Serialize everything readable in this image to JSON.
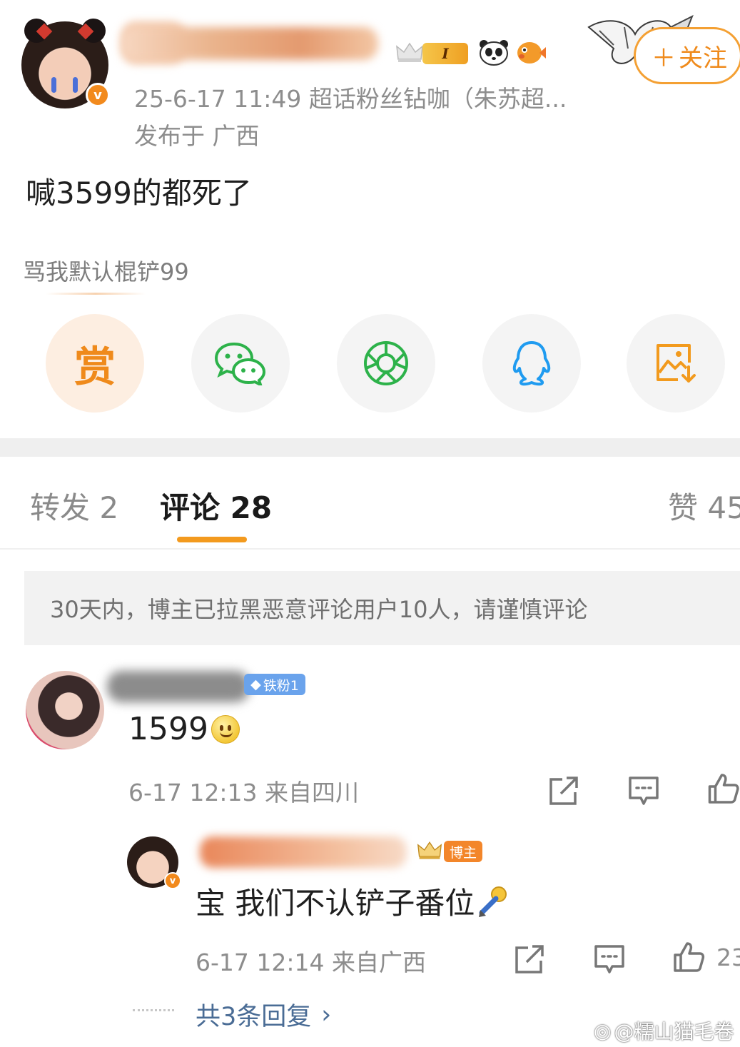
{
  "post": {
    "level_badge": "I",
    "timestamp_source": "25-6-17 11:49  超话粉丝钻咖（朱苏超...",
    "location": "发布于 广西",
    "text": "喊3599的都死了",
    "subtext": "骂我默认棍铲99",
    "follow_label": "关注"
  },
  "share": {
    "reward_label": "赏",
    "items": [
      "reward-icon",
      "wechat-icon",
      "moments-icon",
      "qq-icon",
      "save-image-icon"
    ]
  },
  "tabs": {
    "repost": "转发 2",
    "comment": "评论 28",
    "like": "赞 45"
  },
  "notice": "30天内，博主已拉黑恶意评论用户10人，请谨慎评论",
  "comment": {
    "fan_badge": "铁粉1",
    "text": "1599",
    "meta": "6-17 12:13 来自四川"
  },
  "reply": {
    "author_badge": "博主",
    "text": "宝 我们不认铲子番位",
    "meta": "6-17 12:14 来自广西",
    "like_count": "23",
    "more_replies": "共3条回复"
  },
  "watermark": "@糯山猫毛卷",
  "colors": {
    "accent_orange": "#ef8a1b",
    "link_blue": "#4a6c95",
    "meta_gray": "#8d8d8d"
  }
}
